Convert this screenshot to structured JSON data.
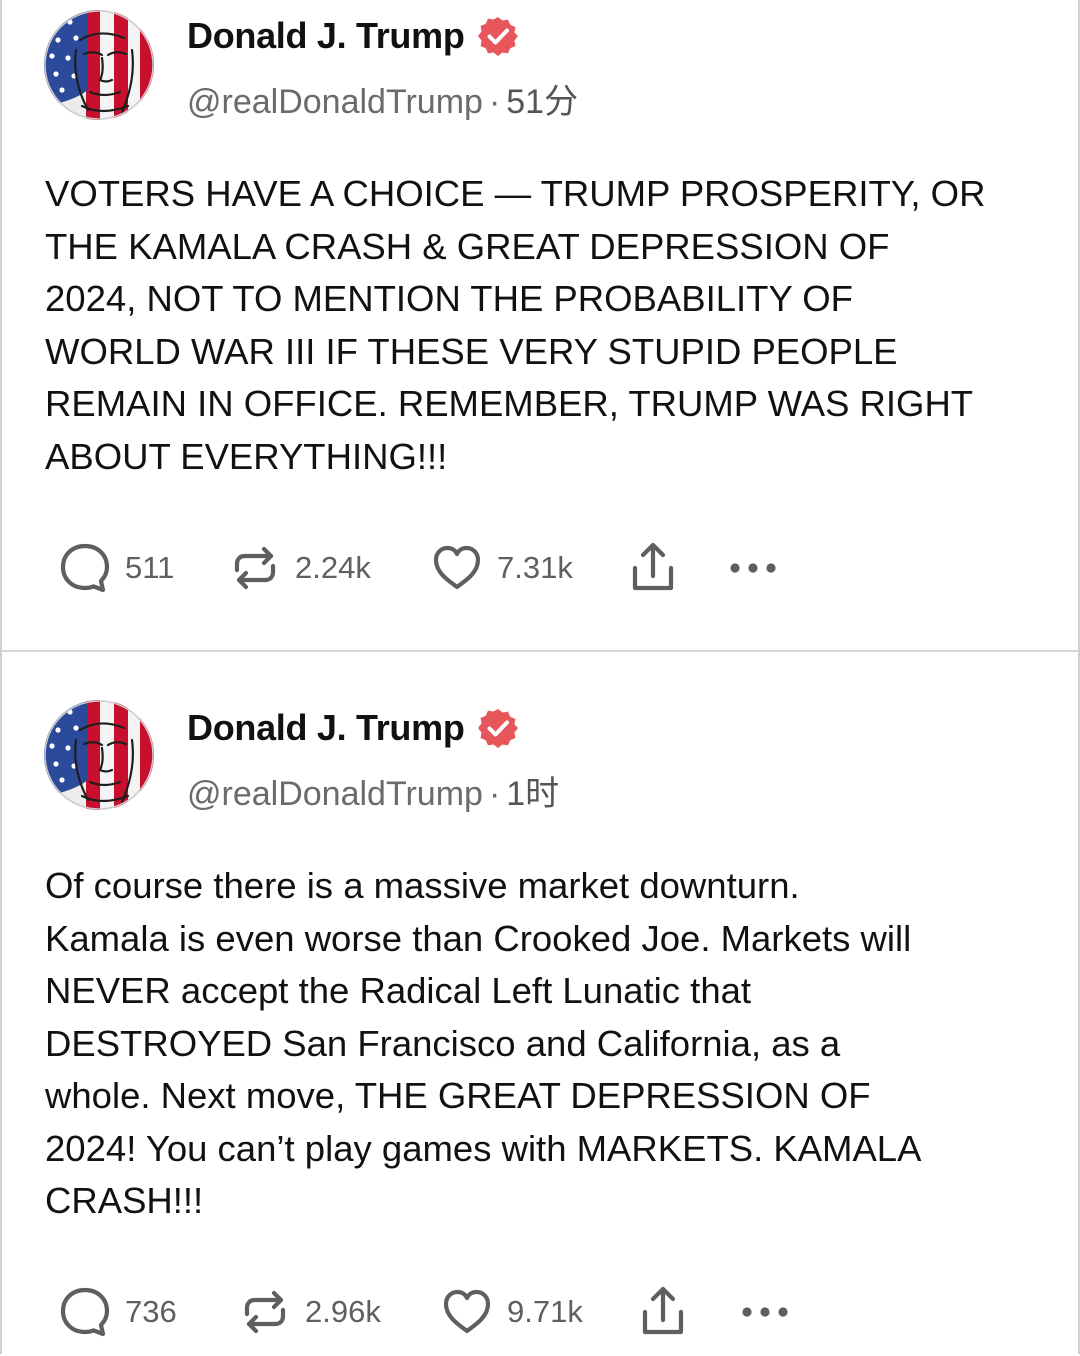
{
  "colors": {
    "badge": "#e6565a",
    "text_primary": "#111111",
    "text_secondary": "#6b6b6b",
    "action_icon": "#5f5f5f"
  },
  "posts": [
    {
      "author": {
        "display_name": "Donald J. Trump",
        "handle": "@realDonaldTrump",
        "verified_icon": "verified-badge-icon",
        "avatar_icon": "flag-portrait-avatar"
      },
      "separator": "·",
      "time": "51分",
      "text": "VOTERS HAVE A CHOICE — TRUMP PROSPERITY, OR\nTHE KAMALA CRASH & GREAT DEPRESSION OF\n2024, NOT TO MENTION THE PROBABILITY OF\nWORLD WAR III IF THESE VERY STUPID PEOPLE\nREMAIN IN OFFICE. REMEMBER, TRUMP WAS RIGHT\nABOUT EVERYTHING!!!",
      "actions": {
        "replies": "511",
        "reposts": "2.24k",
        "likes": "7.31k",
        "reply_icon": "reply-icon",
        "repost_icon": "repost-icon",
        "like_icon": "heart-icon",
        "share_icon": "share-icon",
        "more_icon": "more-icon"
      }
    },
    {
      "author": {
        "display_name": "Donald J. Trump",
        "handle": "@realDonaldTrump",
        "verified_icon": "verified-badge-icon",
        "avatar_icon": "flag-portrait-avatar"
      },
      "separator": "·",
      "time": "1时",
      "text": "Of course there is a massive market downturn.\nKamala is even worse than Crooked Joe. Markets will\nNEVER accept the Radical Left Lunatic that\nDESTROYED San Francisco and California, as a\nwhole. Next move, THE GREAT DEPRESSION OF\n2024! You can’t play games with MARKETS. KAMALA\nCRASH!!!",
      "actions": {
        "replies": "736",
        "reposts": "2.96k",
        "likes": "9.71k",
        "reply_icon": "reply-icon",
        "repost_icon": "repost-icon",
        "like_icon": "heart-icon",
        "share_icon": "share-icon",
        "more_icon": "more-icon"
      }
    }
  ]
}
